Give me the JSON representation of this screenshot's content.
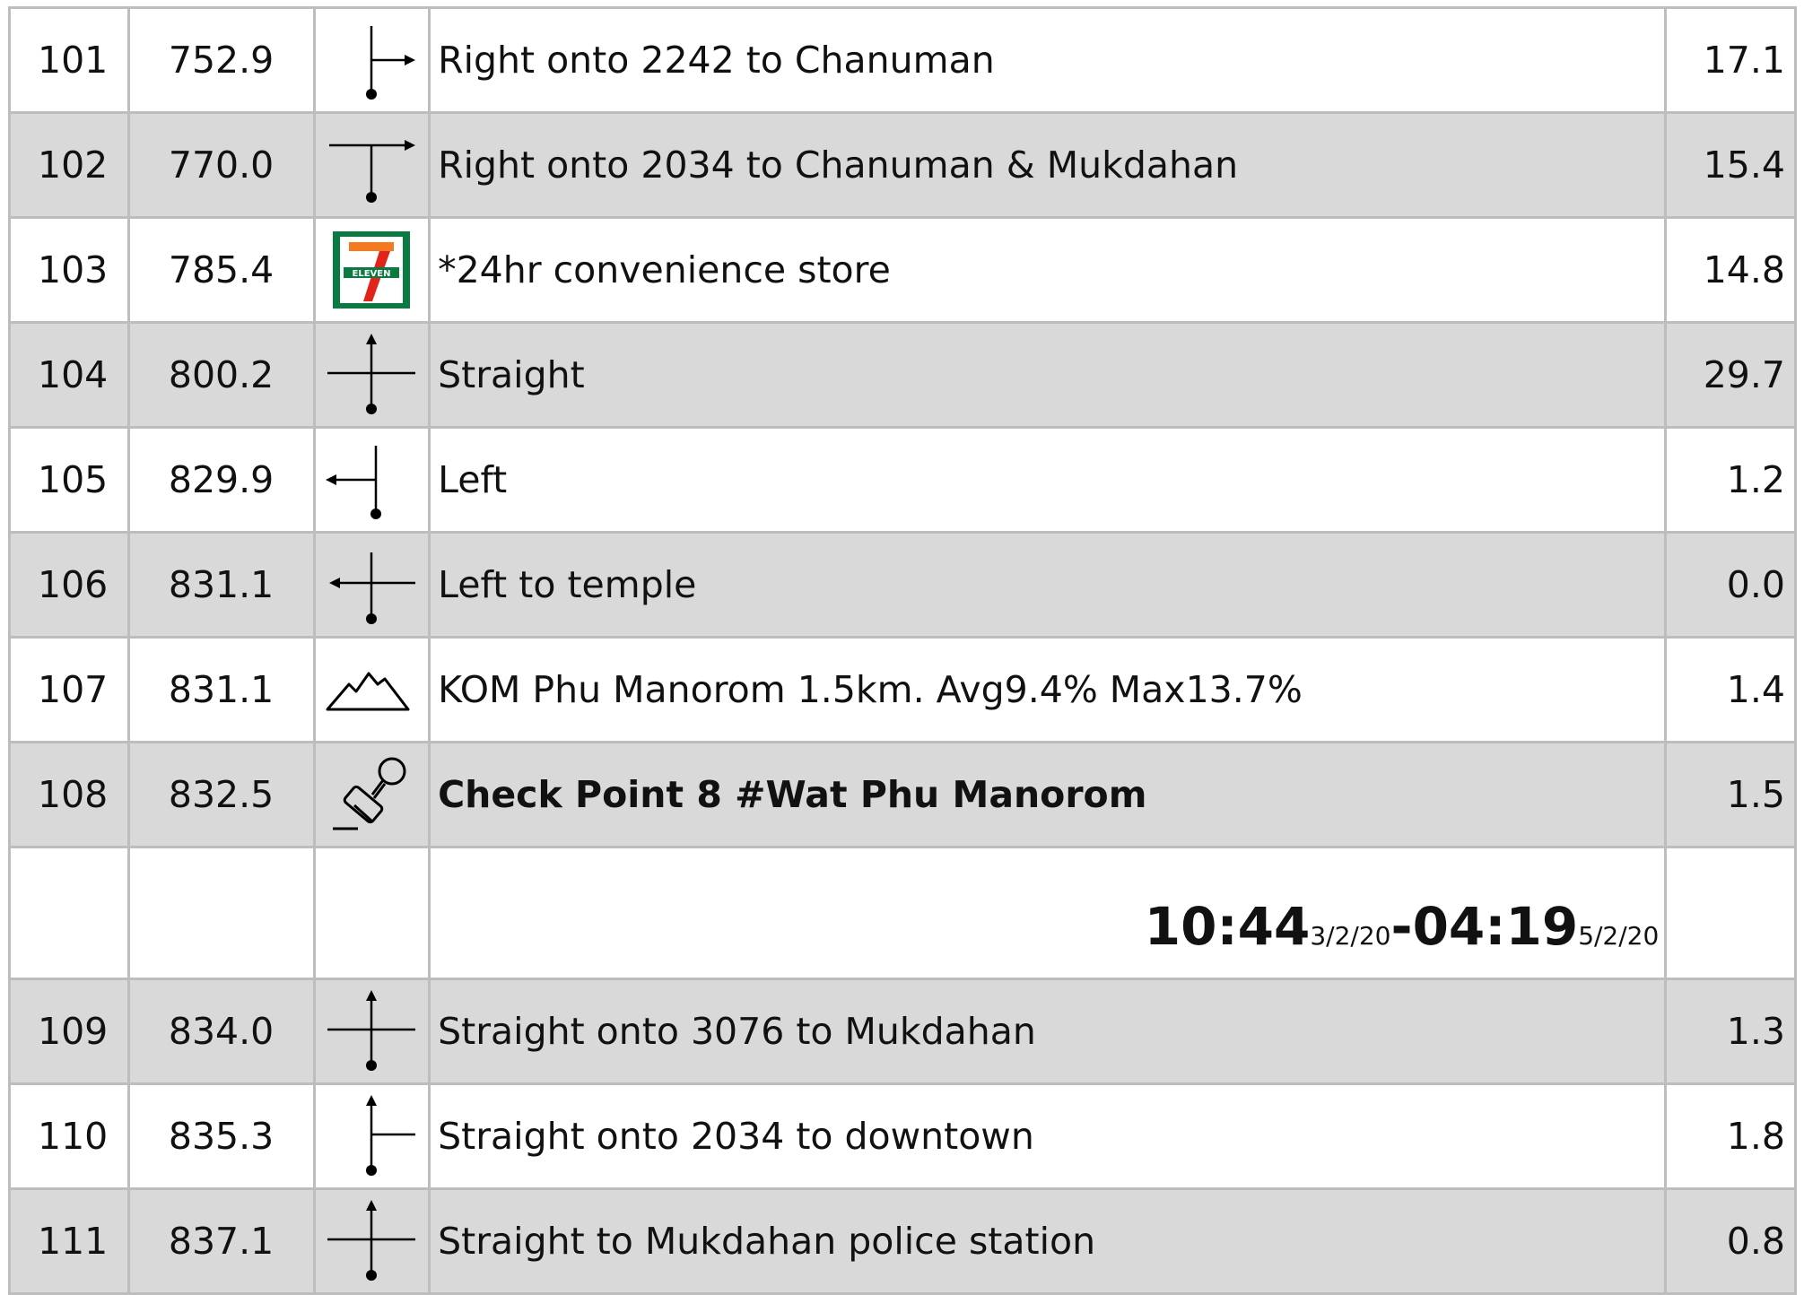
{
  "rows": [
    {
      "no": "101",
      "km": "752.9",
      "icon": "turn-right-from-stem-icon",
      "desc": "Right onto 2242 to Chanuman",
      "dist": "17.1",
      "shade": false,
      "style": "normal"
    },
    {
      "no": "102",
      "km": "770.0",
      "icon": "t-junction-right-icon",
      "desc": "Right onto 2034 to Chanuman & Mukdahan",
      "dist": "15.4",
      "shade": true,
      "style": "normal"
    },
    {
      "no": "103",
      "km": "785.4",
      "icon": "seven-eleven-logo-icon",
      "desc": "*24hr convenience store",
      "dist": "14.8",
      "shade": false,
      "style": "green"
    },
    {
      "no": "104",
      "km": "800.2",
      "icon": "crossroad-straight-icon",
      "desc": "Straight",
      "dist": "29.7",
      "shade": true,
      "style": "normal"
    },
    {
      "no": "105",
      "km": "829.9",
      "icon": "turn-left-from-stem-icon",
      "desc": "Left",
      "dist": "1.2",
      "shade": false,
      "style": "normal"
    },
    {
      "no": "106",
      "km": "831.1",
      "icon": "crossroad-left-icon",
      "desc": "Left to temple",
      "dist": "0.0",
      "shade": true,
      "style": "normal"
    },
    {
      "no": "107",
      "km": "831.1",
      "icon": "mountain-climb-icon",
      "desc": "KOM Phu Manorom 1.5km. Avg9.4% Max13.7%",
      "dist": "1.4",
      "shade": false,
      "style": "red"
    },
    {
      "no": "108",
      "km": "832.5",
      "icon": "stamp-checkpoint-icon",
      "desc": "Check Point 8 #Wat Phu Manorom",
      "dist": "1.5",
      "shade": true,
      "style": "bold"
    }
  ],
  "checkpoint_time": {
    "open_time": "10:44",
    "open_date": "3/2/20",
    "separator": "-",
    "close_time": "04:19",
    "close_date": "5/2/20"
  },
  "rows_after": [
    {
      "no": "109",
      "km": "834.0",
      "icon": "crossroad-straight-icon",
      "desc": "Straight onto 3076 to Mukdahan",
      "dist": "1.3",
      "shade": true,
      "style": "normal"
    },
    {
      "no": "110",
      "km": "835.3",
      "icon": "straight-with-right-branch-icon",
      "desc": "Straight onto 2034 to downtown",
      "dist": "1.8",
      "shade": false,
      "style": "normal"
    },
    {
      "no": "111",
      "km": "837.1",
      "icon": "crossroad-straight-icon",
      "desc": "Straight to Mukdahan police station",
      "dist": "0.8",
      "shade": true,
      "style": "normal"
    }
  ],
  "colors": {
    "shade": "#d9d9d9",
    "border": "#bdbdbd",
    "green_text": "#22a64a",
    "red_text": "#c8141e",
    "seven_eleven_green": "#0a7a43",
    "seven_eleven_orange": "#f47920",
    "seven_eleven_red": "#e2231a"
  }
}
